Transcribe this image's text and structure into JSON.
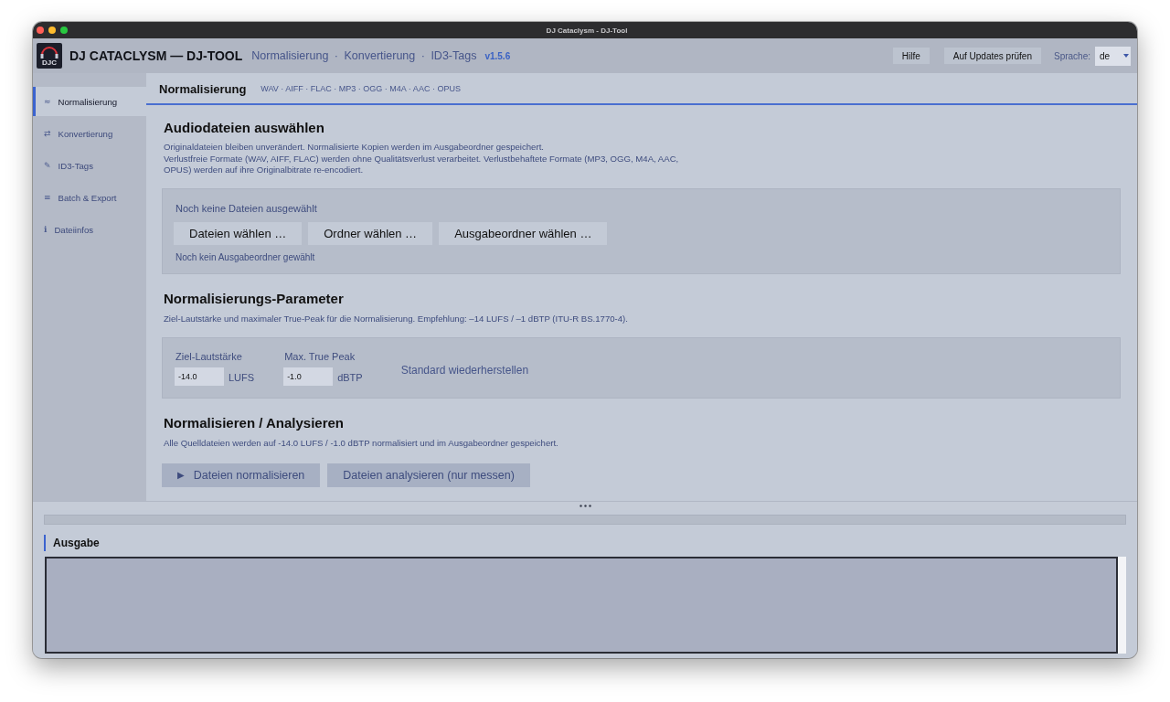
{
  "window": {
    "title": "DJ Cataclysm - DJ-Tool"
  },
  "header": {
    "logo_text": "DJC",
    "app_name": "DJ CATACLYSM — DJ-TOOL",
    "subtitle": "Normalisierung · Konvertierung · ID3-Tags",
    "version": "v1.5.6",
    "buttons": [
      "Hilfe",
      "Auf Updates prüfen"
    ],
    "language": {
      "label": "Sprache:",
      "value": "de"
    }
  },
  "sidebar": {
    "items": [
      {
        "icon": "≈",
        "label": "Normalisierung",
        "selected": true
      },
      {
        "icon": "⇄",
        "label": "Konvertierung",
        "selected": false
      },
      {
        "icon": "✎",
        "label": "ID3-Tags",
        "selected": false
      },
      {
        "icon": "≡",
        "label": "Batch & Export",
        "selected": false
      },
      {
        "icon": "ℹ",
        "label": "Dateiinfos",
        "selected": false
      }
    ]
  },
  "page": {
    "title": "Normalisierung",
    "formats": "WAV · AIFF · FLAC · MP3 · OGG · M4A · AAC · OPUS"
  },
  "file_section": {
    "title": "Audiodateien auswählen",
    "notes": [
      "Originaldateien bleiben unverändert. Normalisierte Kopien werden im Ausgabeordner gespeichert.",
      "Verlustfreie Formate (WAV, AIFF, FLAC) werden ohne Qualitätsverlust verarbeitet. Verlustbehaftete Formate (MP3, OGG, M4A, AAC, OPUS) werden auf ihre Originalbitrate re-encodiert."
    ],
    "status": "Noch keine Dateien ausgewählt",
    "buttons": [
      "Dateien wählen …",
      "Ordner wählen …",
      "Ausgabeordner wählen …"
    ],
    "output_status": "Noch kein Ausgabeordner gewählt"
  },
  "parameter_section": {
    "title": "Normalisierungs-Parameter",
    "note": "Ziel-Lautstärke und maximaler True-Peak für die Normalisierung. Empfehlung: –14 LUFS / –1 dBTP (ITU-R BS.1770-4).",
    "fields": [
      {
        "label": "Ziel-Lautstärke",
        "value": "-14.0",
        "unit": "LUFS"
      },
      {
        "label": "Max. True Peak",
        "value": "-1.0",
        "unit": "dBTP"
      }
    ],
    "reset_button": "Standard wiederherstellen"
  },
  "action_section": {
    "title": "Normalisieren / Analysieren",
    "note": "Alle Quelldateien werden auf -14.0 LUFS / -1.0 dBTP normalisiert und im Ausgabeordner gespeichert.",
    "buttons": [
      {
        "icon": "▶",
        "label": "Dateien normalisieren",
        "disabled": true
      },
      {
        "label": "Dateien analysieren (nur messen)",
        "disabled": true
      }
    ]
  },
  "progress": {
    "level": 0
  },
  "output": {
    "title": "Ausgabe"
  }
}
